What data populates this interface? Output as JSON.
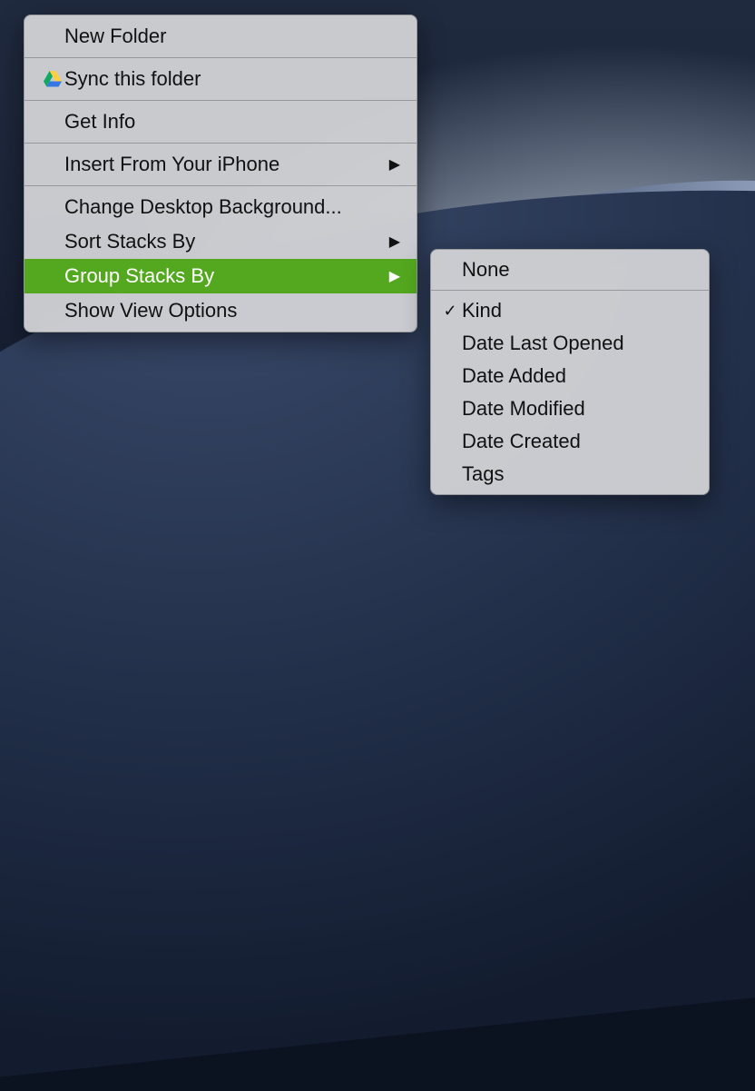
{
  "mainMenu": {
    "newFolder": "New Folder",
    "syncFolder": "Sync this folder",
    "getInfo": "Get Info",
    "insertFromPhone": "Insert From Your iPhone",
    "changeDesktop": "Change Desktop Background...",
    "sortStacksBy": "Sort Stacks By",
    "groupStacksBy": "Group Stacks By",
    "showViewOptions": "Show View Options"
  },
  "subMenu": {
    "none": "None",
    "kind": "Kind",
    "dateLastOpened": "Date Last Opened",
    "dateAdded": "Date Added",
    "dateModified": "Date Modified",
    "dateCreated": "Date Created",
    "tags": "Tags"
  },
  "selected": {
    "main": "groupStacksBy",
    "subChecked": "kind"
  },
  "icons": {
    "submenuArrow": "▶",
    "checkmark": "✓"
  }
}
